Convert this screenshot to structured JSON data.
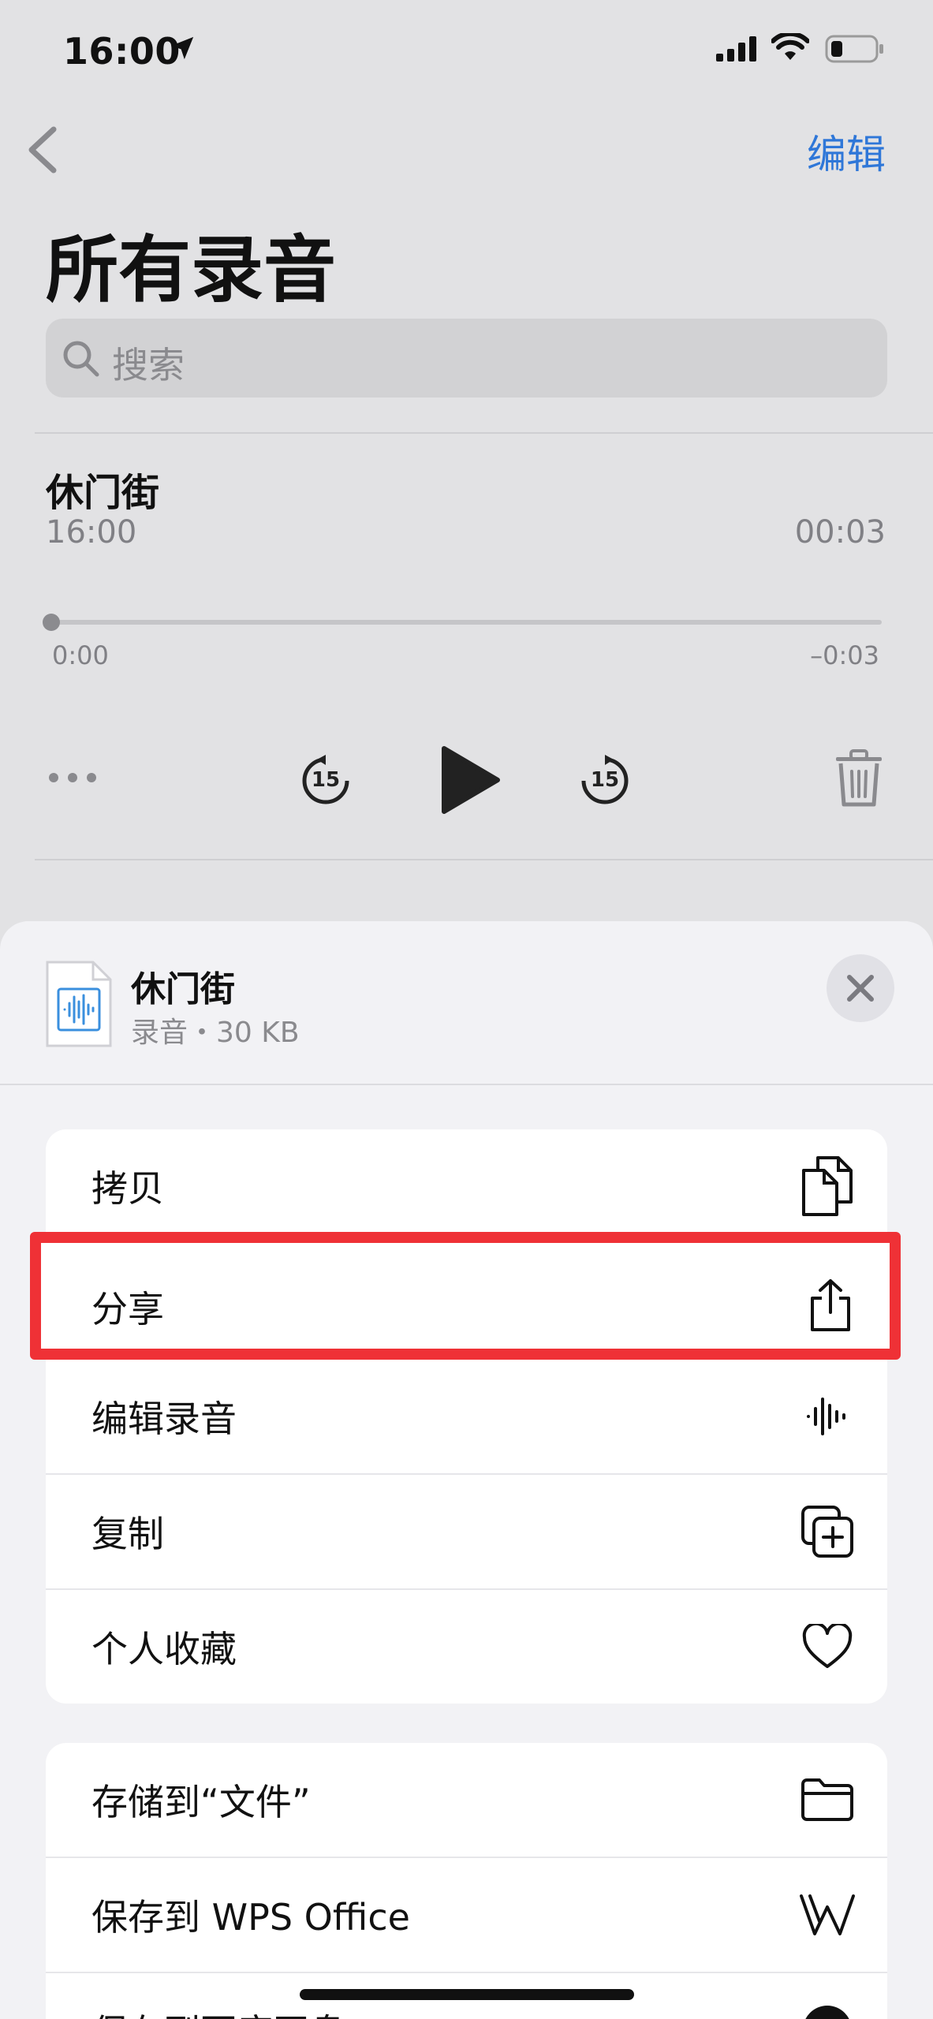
{
  "status_bar": {
    "time": "16:00",
    "icons": [
      "location-arrow-icon",
      "cellular-signal-icon",
      "wifi-icon",
      "battery-icon"
    ]
  },
  "nav": {
    "back_icon": "chevron-left-icon",
    "edit_label": "编辑",
    "accent_color": "#2f77d8"
  },
  "page": {
    "title": "所有录音",
    "search_placeholder": "搜索"
  },
  "recording": {
    "title": "休门街",
    "time": "16:00",
    "duration": "00:03",
    "progress_start": "0:00",
    "progress_end": "–0:03",
    "progress_fraction": 0,
    "skip_seconds": "15"
  },
  "sheet": {
    "file_title": "休门街",
    "file_subtitle": "录音・30 KB",
    "close_icon": "close-icon",
    "group1": [
      {
        "label": "拷贝",
        "icon": "copy-icon"
      },
      {
        "label": "分享",
        "icon": "share-icon"
      },
      {
        "label": "编辑录音",
        "icon": "waveform-icon"
      },
      {
        "label": "复制",
        "icon": "duplicate-icon"
      },
      {
        "label": "个人收藏",
        "icon": "heart-icon"
      }
    ],
    "group2": [
      {
        "label": "存储到“文件”",
        "icon": "folder-icon"
      },
      {
        "label": "保存到 WPS Office",
        "icon": "wps-icon"
      },
      {
        "label": "保存到百度网盘",
        "icon": "cloud-icon"
      }
    ],
    "highlight_color": "#ef3136"
  }
}
